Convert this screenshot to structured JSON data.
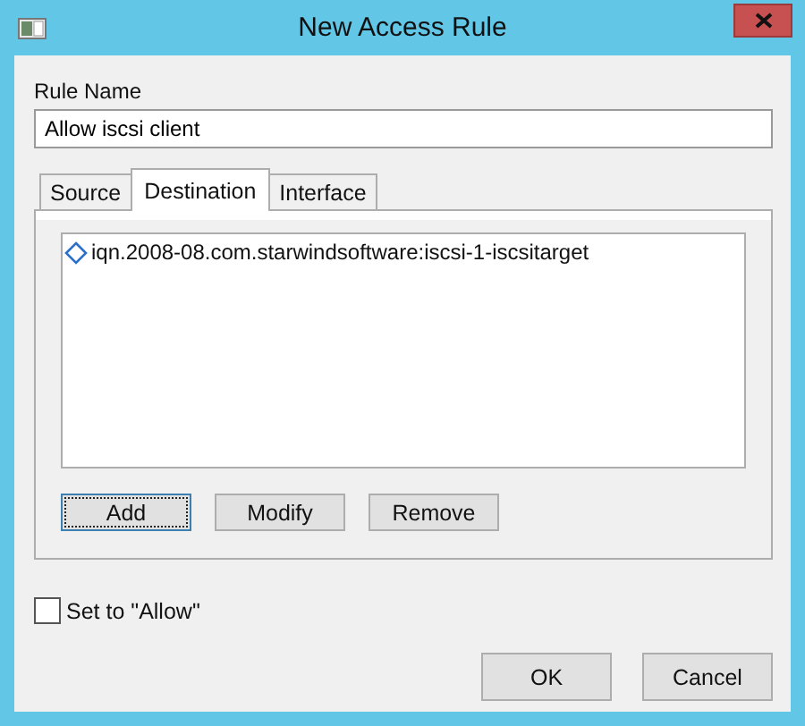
{
  "window": {
    "title": "New Access Rule"
  },
  "rule_name": {
    "label": "Rule Name",
    "value": "Allow iscsi client"
  },
  "tabs": [
    {
      "label": "Source",
      "selected": false
    },
    {
      "label": "Destination",
      "selected": true
    },
    {
      "label": "Interface",
      "selected": false
    }
  ],
  "list": {
    "items": [
      {
        "text": "iqn.2008-08.com.starwindsoftware:iscsi-1-iscsitarget",
        "selected": false
      }
    ]
  },
  "list_buttons": [
    {
      "label": "Add",
      "focused": true
    },
    {
      "label": "Modify",
      "focused": false
    },
    {
      "label": "Remove",
      "focused": false
    }
  ],
  "allow_checkbox": {
    "label": "Set to \"Allow\"",
    "checked": false
  },
  "buttons": [
    "OK",
    "Cancel"
  ]
}
